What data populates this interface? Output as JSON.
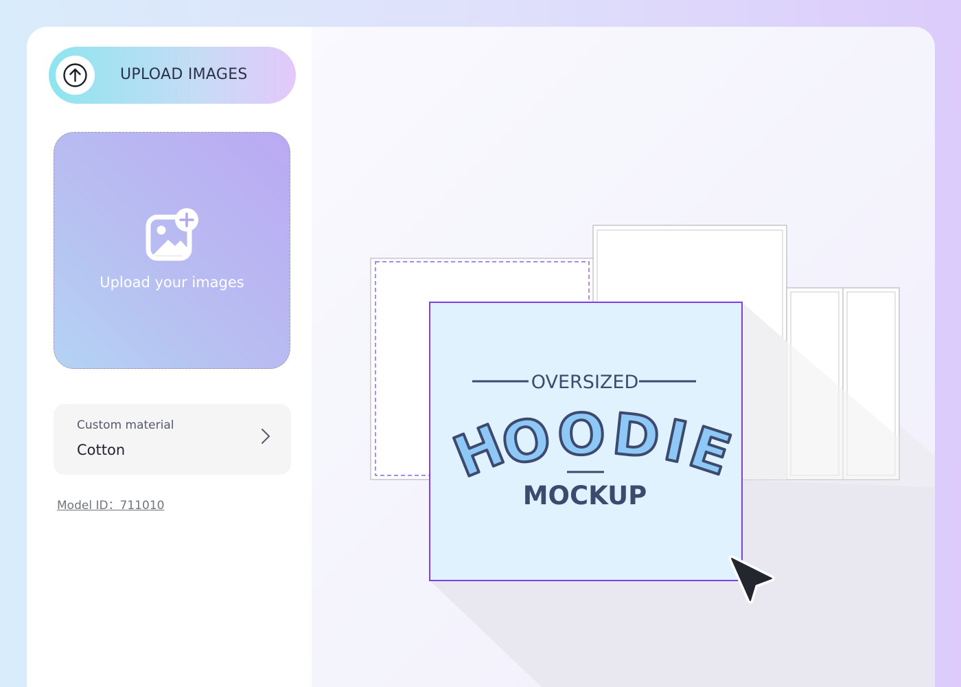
{
  "sidebar": {
    "upload_button": {
      "label": "UPLOAD IMAGES",
      "icon": "arrow-up-circle-icon"
    },
    "dropzone": {
      "text": "Upload your images",
      "icon": "image-add-icon"
    },
    "material": {
      "label": "Custom material",
      "value": "Cotton",
      "icon": "chevron-right-icon"
    },
    "model_id": "Model ID：711010"
  },
  "mockup": {
    "top_text": "OVERSIZED",
    "title": "HOODIE",
    "bottom_text": "MOCKUP"
  },
  "colors": {
    "accent_purple": "#7b3fe4",
    "mockup_bg": "#e0f2fd",
    "title_fill": "#8ec8f6",
    "text_dark": "#3d4a6e"
  }
}
